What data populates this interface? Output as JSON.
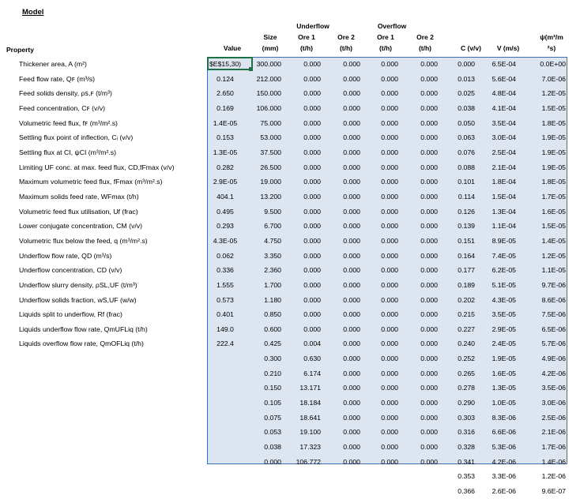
{
  "title": "Model",
  "headers": {
    "property": "Property",
    "value": "Value",
    "size": [
      "Size",
      "(mm)"
    ],
    "underflow": "Underflow",
    "overflow": "Overflow",
    "uf_ore1": [
      "Ore 1",
      "(t/h)"
    ],
    "uf_ore2": [
      "Ore 2",
      "(t/h)"
    ],
    "of_ore1": [
      "Ore 1",
      "(t/h)"
    ],
    "of_ore2": [
      "Ore 2",
      "(t/h)"
    ],
    "c": "C (v/v)",
    "v": "V (m/s)",
    "psi": [
      "ψ(m³/m",
      "²s)"
    ]
  },
  "active_cell": "$E$15,30)",
  "properties": [
    {
      "label": "Thickener area, A (m²)",
      "value": "$E$15,30)"
    },
    {
      "label": "Feed flow rate, Qꜰ (m³/s)",
      "value": "0.124"
    },
    {
      "label": "Feed solids density, ρꜱ,ꜰ (t/m³)",
      "value": "2.650"
    },
    {
      "label": "Feed concentration, Cꜰ (v/v)",
      "value": "0.169"
    },
    {
      "label": "Volumetric feed flux, fꜰ (m³/m².s)",
      "value": "1.4E-05"
    },
    {
      "label": "Settling flux point of inflection, Cᵢ (v/v)",
      "value": "0.153"
    },
    {
      "label": "Settling flux at CI, ψCI (m³/m².s)",
      "value": "1.3E-05"
    },
    {
      "label": "Limiting UF conc. at max. feed flux, CD,fFmax (v/v)",
      "value": "0.282"
    },
    {
      "label": "Maximum volumetric feed flux, fFmax (m³/m².s)",
      "value": "2.9E-05"
    },
    {
      "label": "Maximum solids feed rate, WFmax (t/h)",
      "value": "404.1"
    },
    {
      "label": "Volumetric feed flux utilisation, Uf (frac)",
      "value": "0.495"
    },
    {
      "label": "Lower conjugate concentration, CM (v/v)",
      "value": "0.293"
    },
    {
      "label": "Volumetric flux below the feed, q (m³/m².s)",
      "value": "4.3E-05"
    },
    {
      "label": "Underflow flow rate, QD (m³/s)",
      "value": "0.062"
    },
    {
      "label": "Underflow concentration, CD (v/v)",
      "value": "0.336"
    },
    {
      "label": "Underflow slurry density, ρSL,UF (t/m³)",
      "value": "1.555"
    },
    {
      "label": "Underflow solids fraction, wS,UF (w/w)",
      "value": "0.573"
    },
    {
      "label": "Liquids split to underflow, Rf (frac)",
      "value": "0.401"
    },
    {
      "label": "Liquids underflow flow rate, QmUFLiq (t/h)",
      "value": "149.0"
    },
    {
      "label": "Liquids overflow flow rate, QmOFLiq (t/h)",
      "value": "222.4"
    }
  ],
  "rows": [
    [
      "300.000",
      "0.000",
      "0.000",
      "0.000",
      "0.000",
      "0.000",
      "6.5E-04",
      "0.0E+00"
    ],
    [
      "212.000",
      "0.000",
      "0.000",
      "0.000",
      "0.000",
      "0.013",
      "5.6E-04",
      "7.0E-06"
    ],
    [
      "150.000",
      "0.000",
      "0.000",
      "0.000",
      "0.000",
      "0.025",
      "4.8E-04",
      "1.2E-05"
    ],
    [
      "106.000",
      "0.000",
      "0.000",
      "0.000",
      "0.000",
      "0.038",
      "4.1E-04",
      "1.5E-05"
    ],
    [
      "75.000",
      "0.000",
      "0.000",
      "0.000",
      "0.000",
      "0.050",
      "3.5E-04",
      "1.8E-05"
    ],
    [
      "53.000",
      "0.000",
      "0.000",
      "0.000",
      "0.000",
      "0.063",
      "3.0E-04",
      "1.9E-05"
    ],
    [
      "37.500",
      "0.000",
      "0.000",
      "0.000",
      "0.000",
      "0.076",
      "2.5E-04",
      "1.9E-05"
    ],
    [
      "26.500",
      "0.000",
      "0.000",
      "0.000",
      "0.000",
      "0.088",
      "2.1E-04",
      "1.9E-05"
    ],
    [
      "19.000",
      "0.000",
      "0.000",
      "0.000",
      "0.000",
      "0.101",
      "1.8E-04",
      "1.8E-05"
    ],
    [
      "13.200",
      "0.000",
      "0.000",
      "0.000",
      "0.000",
      "0.114",
      "1.5E-04",
      "1.7E-05"
    ],
    [
      "9.500",
      "0.000",
      "0.000",
      "0.000",
      "0.000",
      "0.126",
      "1.3E-04",
      "1.6E-05"
    ],
    [
      "6.700",
      "0.000",
      "0.000",
      "0.000",
      "0.000",
      "0.139",
      "1.1E-04",
      "1.5E-05"
    ],
    [
      "4.750",
      "0.000",
      "0.000",
      "0.000",
      "0.000",
      "0.151",
      "8.9E-05",
      "1.4E-05"
    ],
    [
      "3.350",
      "0.000",
      "0.000",
      "0.000",
      "0.000",
      "0.164",
      "7.4E-05",
      "1.2E-05"
    ],
    [
      "2.360",
      "0.000",
      "0.000",
      "0.000",
      "0.000",
      "0.177",
      "6.2E-05",
      "1.1E-05"
    ],
    [
      "1.700",
      "0.000",
      "0.000",
      "0.000",
      "0.000",
      "0.189",
      "5.1E-05",
      "9.7E-06"
    ],
    [
      "1.180",
      "0.000",
      "0.000",
      "0.000",
      "0.000",
      "0.202",
      "4.3E-05",
      "8.6E-06"
    ],
    [
      "0.850",
      "0.000",
      "0.000",
      "0.000",
      "0.000",
      "0.215",
      "3.5E-05",
      "7.5E-06"
    ],
    [
      "0.600",
      "0.000",
      "0.000",
      "0.000",
      "0.000",
      "0.227",
      "2.9E-05",
      "6.5E-06"
    ],
    [
      "0.425",
      "0.004",
      "0.000",
      "0.000",
      "0.000",
      "0.240",
      "2.4E-05",
      "5.7E-06"
    ],
    [
      "0.300",
      "0.630",
      "0.000",
      "0.000",
      "0.000",
      "0.252",
      "1.9E-05",
      "4.9E-06"
    ],
    [
      "0.210",
      "6.174",
      "0.000",
      "0.000",
      "0.000",
      "0.265",
      "1.6E-05",
      "4.2E-06"
    ],
    [
      "0.150",
      "13.171",
      "0.000",
      "0.000",
      "0.000",
      "0.278",
      "1.3E-05",
      "3.5E-06"
    ],
    [
      "0.105",
      "18.184",
      "0.000",
      "0.000",
      "0.000",
      "0.290",
      "1.0E-05",
      "3.0E-06"
    ],
    [
      "0.075",
      "18.641",
      "0.000",
      "0.000",
      "0.000",
      "0.303",
      "8.3E-06",
      "2.5E-06"
    ],
    [
      "0.053",
      "19.100",
      "0.000",
      "0.000",
      "0.000",
      "0.316",
      "6.6E-06",
      "2.1E-06"
    ],
    [
      "0.038",
      "17.323",
      "0.000",
      "0.000",
      "0.000",
      "0.328",
      "5.3E-06",
      "1.7E-06"
    ],
    [
      "0.000",
      "106.772",
      "0.000",
      "0.000",
      "0.000",
      "0.341",
      "4.2E-06",
      "1.4E-06"
    ],
    [
      "",
      "",
      "",
      "",
      "",
      "0.353",
      "3.3E-06",
      "1.2E-06"
    ],
    [
      "",
      "",
      "",
      "",
      "",
      "0.366",
      "2.6E-06",
      "9.6E-07"
    ]
  ]
}
